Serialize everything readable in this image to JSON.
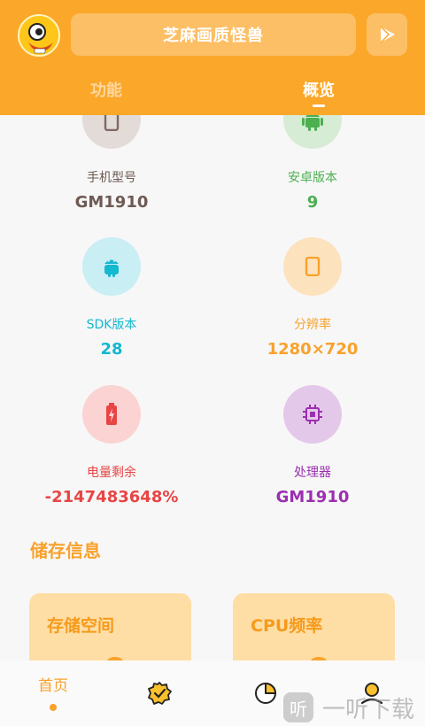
{
  "header": {
    "title": "芝麻画质怪兽",
    "tabs": [
      {
        "label": "功能"
      },
      {
        "label": "概览"
      }
    ],
    "colors": {
      "bar": "#fba72a",
      "active_tab": "#ffffff"
    }
  },
  "overview": {
    "items": [
      {
        "label": "手机型号",
        "value": "GM1910",
        "icon": "phone-icon",
        "color": "#6d5a53"
      },
      {
        "label": "安卓版本",
        "value": "9",
        "icon": "android-icon",
        "color": "#4caf50"
      },
      {
        "label": "SDK版本",
        "value": "28",
        "icon": "android-icon",
        "color": "#14b8cf"
      },
      {
        "label": "分辨率",
        "value": "1280×720",
        "icon": "screen-icon",
        "color": "#f9a12b"
      },
      {
        "label": "电量剩余",
        "value": "-2147483648%",
        "icon": "battery-icon",
        "color": "#e84545"
      },
      {
        "label": "处理器",
        "value": "GM1910",
        "icon": "cpu-icon",
        "color": "#9b2fb0"
      }
    ]
  },
  "storage": {
    "title": "储存信息",
    "cards": [
      {
        "title": "存储空间"
      },
      {
        "title": "CPU频率"
      }
    ]
  },
  "bottom_nav": {
    "items": [
      {
        "label": "首页",
        "icon": "home-icon",
        "active": true
      },
      {
        "label": "",
        "icon": "badge-check-icon"
      },
      {
        "label": "",
        "icon": "pie-chart-icon"
      },
      {
        "label": "",
        "icon": "user-icon"
      }
    ]
  },
  "watermark": {
    "badge": "听",
    "text": "一听下载"
  }
}
